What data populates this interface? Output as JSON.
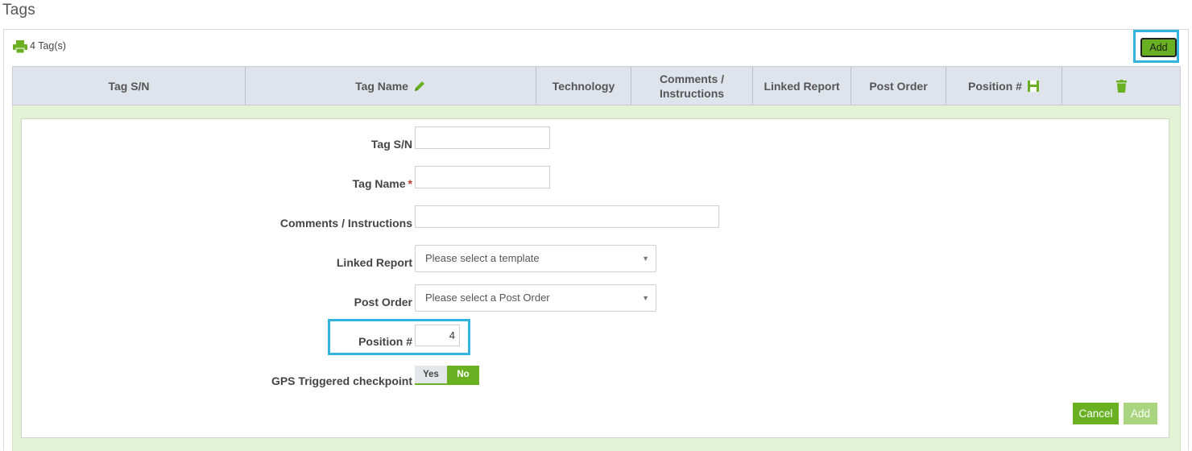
{
  "page": {
    "title": "Tags"
  },
  "header": {
    "count_label": "4 Tag(s)",
    "add_label": "Add",
    "print_icon": "printer-icon"
  },
  "table": {
    "columns": [
      {
        "label": "Tag S/N"
      },
      {
        "label": "Tag Name",
        "icon": "pencil-icon"
      },
      {
        "label": "Technology"
      },
      {
        "label": "Comments / Instructions"
      },
      {
        "label": "Linked Report"
      },
      {
        "label": "Post Order"
      },
      {
        "label": "Position #",
        "icon": "save-icon"
      },
      {
        "label": "",
        "icon": "trash-icon"
      }
    ]
  },
  "form": {
    "tag_sn": {
      "label": "Tag S/N",
      "value": ""
    },
    "tag_name": {
      "label": "Tag Name",
      "required_mark": "*",
      "value": ""
    },
    "comments": {
      "label": "Comments / Instructions",
      "value": ""
    },
    "linked_report": {
      "label": "Linked Report",
      "selected": "Please select a template"
    },
    "post_order": {
      "label": "Post Order",
      "selected": "Please select a Post Order"
    },
    "position": {
      "label": "Position #",
      "value": "4"
    },
    "gps": {
      "label": "GPS Triggered checkpoint",
      "yes_label": "Yes",
      "no_label": "No",
      "selected": "No"
    },
    "cancel_label": "Cancel",
    "add_label": "Add"
  },
  "colors": {
    "accent_green": "#6ab023",
    "highlight_blue": "#33b3df",
    "header_bg": "#dfe4ec",
    "form_area_bg": "#e3f2d4"
  }
}
